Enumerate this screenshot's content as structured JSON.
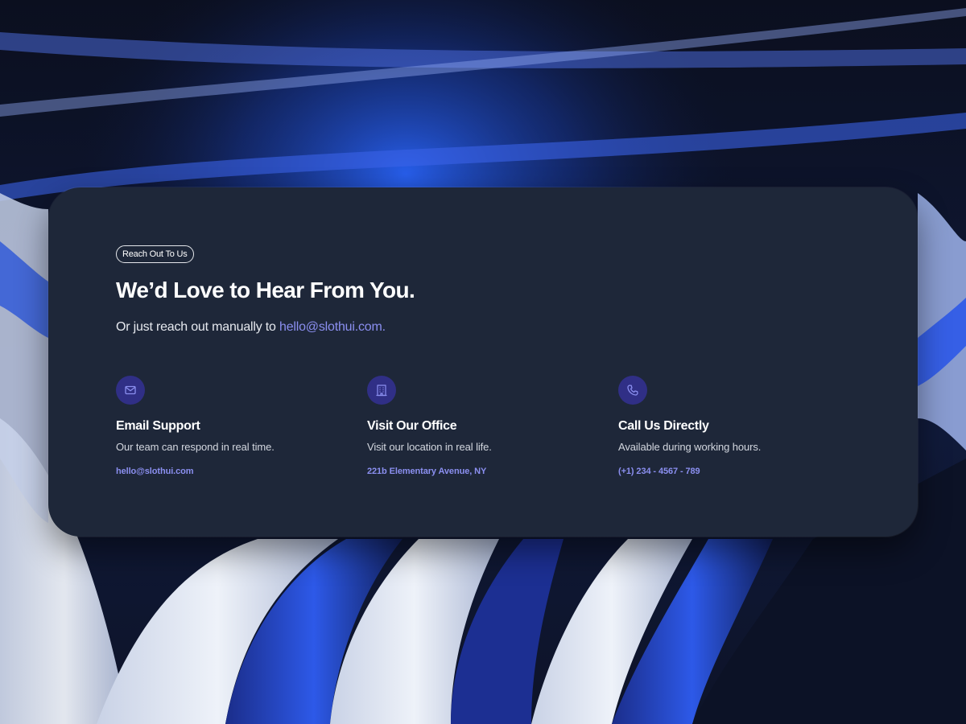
{
  "card": {
    "tag": "Reach Out To Us",
    "title": "We’d Love to Hear From You.",
    "subtitle_prefix": "Or just reach out manually to ",
    "subtitle_email": "hello@slothui.com."
  },
  "contacts": [
    {
      "icon": "mail-icon",
      "title": "Email Support",
      "description": "Our team can respond in real time.",
      "link": "hello@slothui.com"
    },
    {
      "icon": "building-icon",
      "title": "Visit Our Office",
      "description": "Visit our location in real life.",
      "link": "221b Elementary Avenue, NY"
    },
    {
      "icon": "phone-icon",
      "title": "Call Us Directly",
      "description": "Available during working hours.",
      "link": "(+1) 234 - 4567 - 789"
    }
  ],
  "colors": {
    "card_background": "#1e2739",
    "accent": "#8b8ff0",
    "icon_circle": "#302f86",
    "background": "#0a0f1f"
  }
}
